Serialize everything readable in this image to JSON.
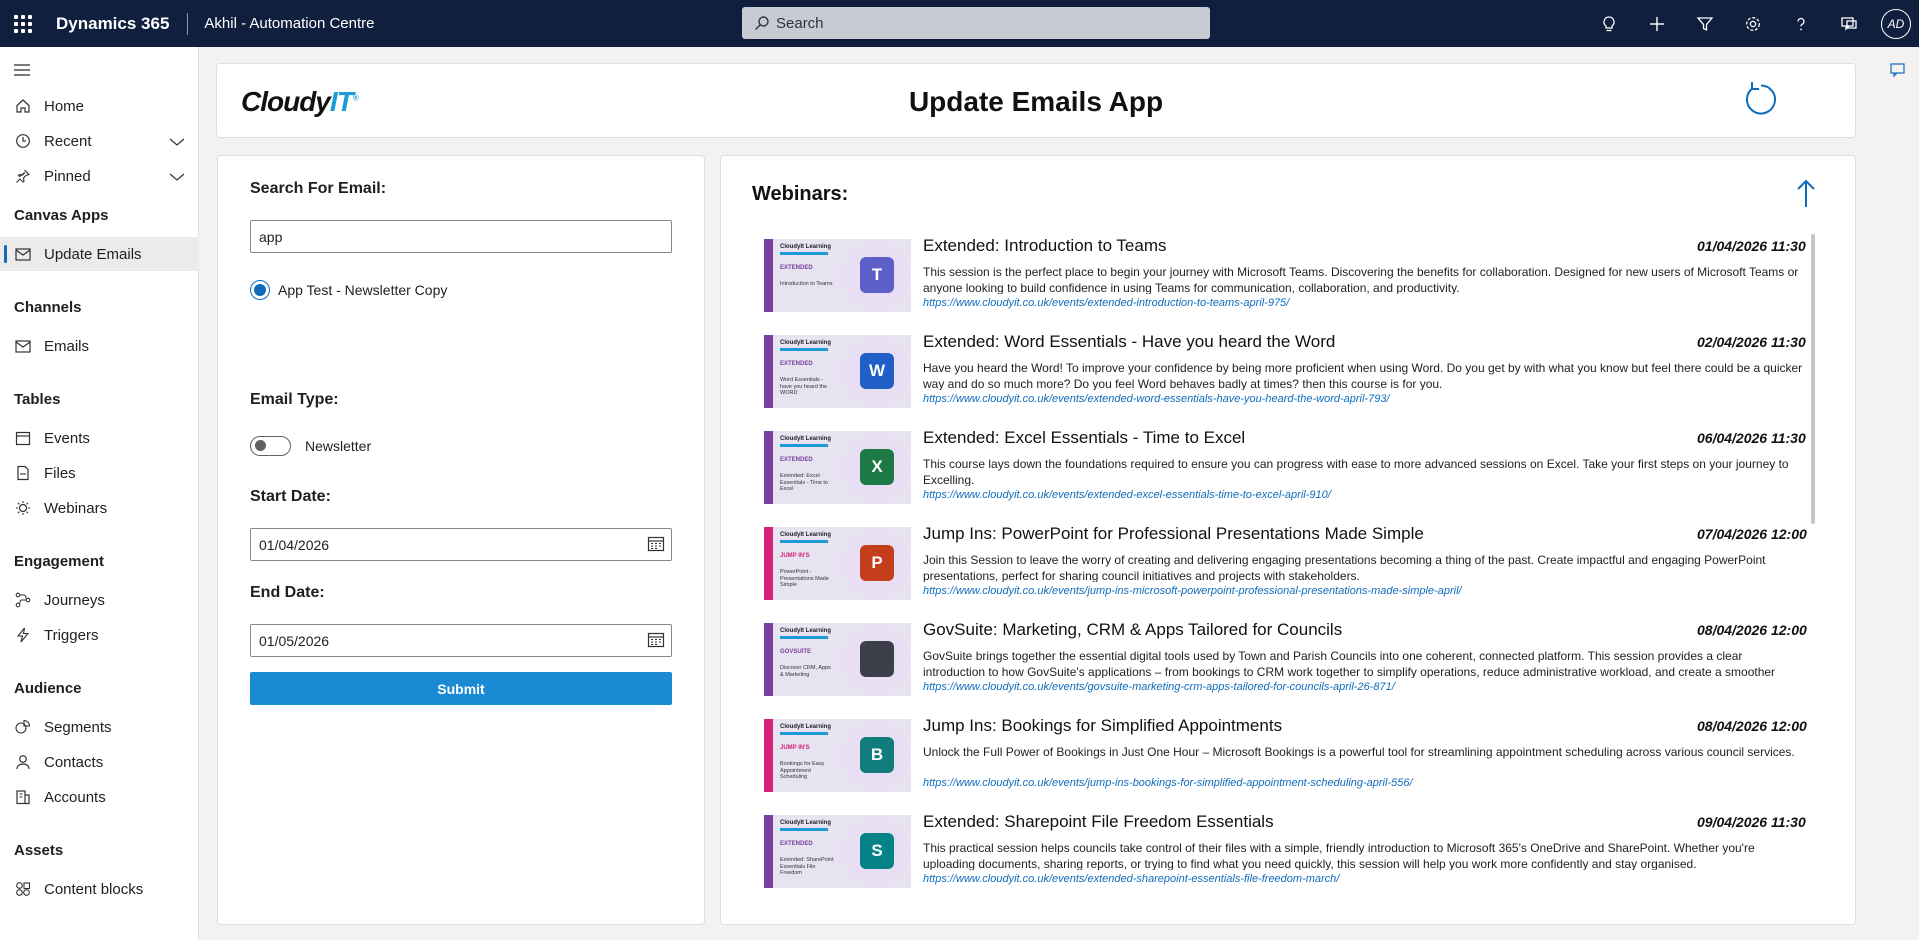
{
  "topbar": {
    "brand": "Dynamics 365",
    "app_name": "Akhil - Automation Centre",
    "search_placeholder": "Search",
    "avatar_initials": "AD",
    "icons": [
      "lightbulb-icon",
      "plus-icon",
      "filter-icon",
      "gear-icon",
      "help-icon",
      "chat-icon"
    ]
  },
  "nav": {
    "items": {
      "home": "Home",
      "recent": "Recent",
      "pinned": "Pinned"
    },
    "sections": {
      "canvas_apps": "Canvas Apps",
      "channels": "Channels",
      "tables": "Tables",
      "engagement": "Engagement",
      "audience": "Audience",
      "assets": "Assets"
    },
    "canvas_apps": {
      "update_emails": "Update Emails"
    },
    "channels": {
      "emails": "Emails"
    },
    "tables": {
      "events": "Events",
      "files": "Files",
      "webinars": "Webinars"
    },
    "engagement": {
      "journeys": "Journeys",
      "triggers": "Triggers"
    },
    "audience": {
      "segments": "Segments",
      "contacts": "Contacts",
      "accounts": "Accounts"
    },
    "assets": {
      "content_blocks": "Content blocks"
    }
  },
  "header": {
    "logo_main": "Cloudy",
    "logo_accent": "IT",
    "logo_mark": "®",
    "title": "Update Emails App"
  },
  "form": {
    "search_label": "Search For Email:",
    "search_value": "app",
    "radio_option": "App Test - Newsletter Copy",
    "email_type_label": "Email Type:",
    "email_type_toggle": "Newsletter",
    "start_date_label": "Start Date:",
    "start_date_value": "01/04/2026",
    "end_date_label": "End Date:",
    "end_date_value": "01/05/2026",
    "submit_label": "Submit"
  },
  "webinars": {
    "title": "Webinars:",
    "items": [
      {
        "title": "Extended: Introduction to Teams",
        "date": "01/04/2026 11:30",
        "description": "This session is the perfect place to begin your journey with Microsoft Teams. Discovering the benefits for collaboration. Designed for new users of Microsoft Teams or anyone looking to build confidence in using Teams for communication, collaboration, and productivity.",
        "link": "https://www.cloudyit.co.uk/events/extended-introduction-to-teams-april-975/",
        "thumb_tag": "EXTENDED",
        "thumb_text": "Introduction to Teams",
        "thumb_letter": "T",
        "thumb_color": "#5b5fc7",
        "stripe_color": "#7b3fa0"
      },
      {
        "title": "Extended: Word Essentials - Have you heard the Word",
        "date": "02/04/2026 11:30",
        "description": "Have you heard the Word! To improve your confidence by being more proficient when using Word.  Do you get by with what you know but feel there could be a quicker way and do so much more? Do you feel Word behaves badly at times? then this course is for you.",
        "link": "https://www.cloudyit.co.uk/events/extended-word-essentials-have-you-heard-the-word-april-793/",
        "thumb_tag": "EXTENDED",
        "thumb_text": "Word Essentials - have you heard the WORD",
        "thumb_letter": "W",
        "thumb_color": "#1f5fc7",
        "stripe_color": "#7b3fa0"
      },
      {
        "title": "Extended: Excel Essentials - Time to Excel",
        "date": "06/04/2026 11:30",
        "description": "This course lays down the foundations required to ensure you can progress with ease to more advanced sessions on Excel. Take your first steps on your journey to Excelling.",
        "link": "https://www.cloudyit.co.uk/events/extended-excel-essentials-time-to-excel-april-910/",
        "thumb_tag": "EXTENDED",
        "thumb_text": "Extended: Excel Essentials - Time to Excel",
        "thumb_letter": "X",
        "thumb_color": "#1d7a45",
        "stripe_color": "#7b3fa0"
      },
      {
        "title": "Jump Ins: PowerPoint for Professional Presentations Made Simple",
        "date": "07/04/2026 12:00",
        "description": "Join this Session to leave the worry of creating and delivering engaging presentations becoming a thing of the past. Create impactful and engaging PowerPoint presentations, perfect for sharing council initiatives and projects with stakeholders.",
        "link": "https://www.cloudyit.co.uk/events/jump-ins-microsoft-powerpoint-professional-presentations-made-simple-april/",
        "thumb_tag": "JUMP IN'S",
        "thumb_text": "PowerPoint - Presentations Made Simple",
        "thumb_letter": "P",
        "thumb_color": "#c43e1c",
        "stripe_color": "#d6227a"
      },
      {
        "title": "GovSuite: Marketing, CRM & Apps Tailored for Councils",
        "date": "08/04/2026 12:00",
        "description": "GovSuite brings together the essential digital tools used by Town and Parish Councils into one coherent, connected platform. This session provides a clear introduction to how GovSuite's applications – from bookings to CRM work together to simplify operations, reduce administrative workload, and create a smoother experience for",
        "link": "https://www.cloudyit.co.uk/events/govsuite-marketing-crm-apps-tailored-for-councils-april-26-871/",
        "thumb_tag": "GOVSUITE",
        "thumb_text": "Discover CRM, Apps & Marketing",
        "thumb_letter": "",
        "thumb_color": "#3a3f4a",
        "stripe_color": "#7b3fa0"
      },
      {
        "title": "Jump Ins: Bookings for Simplified Appointments",
        "date": "08/04/2026 12:00",
        "description": "Unlock the Full Power of Bookings in Just One Hour – Microsoft Bookings is a powerful tool for streamlining appointment scheduling across various council services.",
        "link": "https://www.cloudyit.co.uk/events/jump-ins-bookings-for-simplified-appointment-scheduling-april-556/",
        "thumb_tag": "JUMP IN'S",
        "thumb_text": "Bookings for Easy Appointment Scheduling",
        "thumb_letter": "B",
        "thumb_color": "#107c7c",
        "stripe_color": "#d6227a"
      },
      {
        "title": "Extended: Sharepoint File Freedom Essentials",
        "date": "09/04/2026 11:30",
        "description": "This practical session helps councils take control of their files with a simple, friendly introduction to Microsoft 365's OneDrive and SharePoint. Whether you're uploading documents, sharing reports, or trying to find what you need quickly, this session will help you work more confidently and stay organised.",
        "link": "https://www.cloudyit.co.uk/events/extended-sharepoint-essentials-file-freedom-march/",
        "thumb_tag": "EXTENDED",
        "thumb_text": "Extended: SharePoint Essentials File Freedom",
        "thumb_letter": "S",
        "thumb_color": "#038387",
        "stripe_color": "#7b3fa0"
      }
    ],
    "thumb_brand": "CloudyIt Learning"
  }
}
